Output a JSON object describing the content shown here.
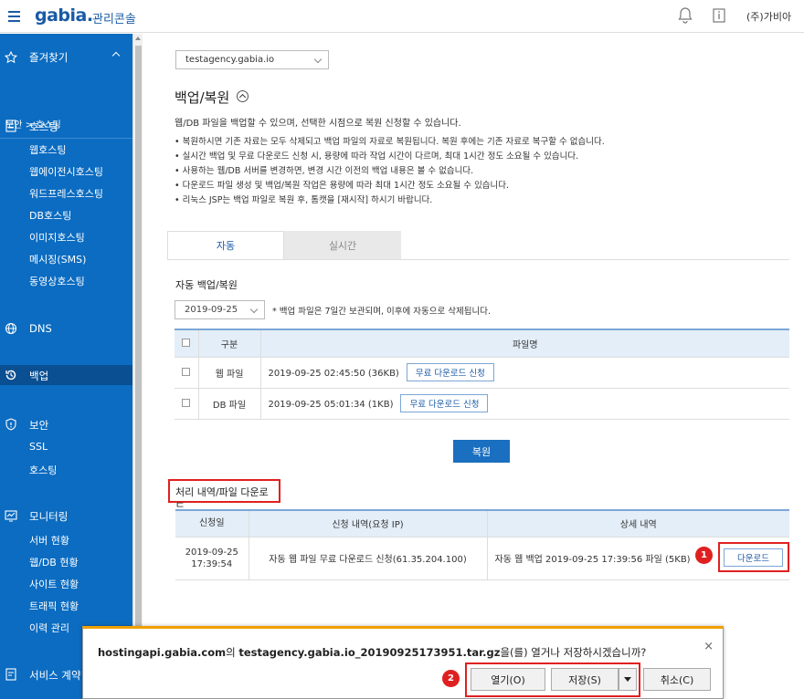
{
  "topbar": {
    "logo": "gabia.",
    "console": "관리콘솔",
    "user": "(주)가비아"
  },
  "sidebar": {
    "favorites": "즐겨찾기",
    "breadcrumb": "보안 > 호스팅",
    "hosting": "호스팅",
    "hosting_items": [
      "웹호스팅",
      "웹에이전시호스팅",
      "워드프레스호스팅",
      "DB호스팅",
      "이미지호스팅",
      "메시징(SMS)",
      "동영상호스팅"
    ],
    "dns": "DNS",
    "backup": "백업",
    "security": "보안",
    "security_items": [
      "SSL",
      "호스팅"
    ],
    "monitoring": "모니터링",
    "monitoring_items": [
      "서버 현황",
      "웹/DB 현황",
      "사이트 현황",
      "트래픽 현황",
      "이력 관리"
    ],
    "contract": "서비스 계약 관"
  },
  "main": {
    "site_select": "testagency.gabia.io",
    "title": "백업/복원",
    "desc": "웹/DB 파일을 백업할 수 있으며, 선택한 시점으로 복원 신청할 수 있습니다.",
    "notes": [
      "복원하시면 기존 자료는 모두 삭제되고 백업 파일의 자료로 복원됩니다. 복원 후에는 기존 자료로 복구할 수 없습니다.",
      "실시간 백업 및 무료 다운로드 신청 시, 용량에 따라 작업 시간이 다르며, 최대 1시간 정도 소요될 수 있습니다.",
      "사용하는 웹/DB 서버를 변경하면, 변경 시간 이전의 백업 내용은 볼 수 없습니다.",
      "다운로드 파일 생성 및 백업/복원 작업은 용량에 따라 최대 1시간 정도 소요될 수 있습니다.",
      "리눅스 JSP는 백업 파일로 복원 후, 톰캣을 [재시작] 하시기 바랍니다."
    ],
    "tabs": [
      "자동",
      "실시간"
    ],
    "auto_title": "자동 백업/복원",
    "date": "2019-09-25",
    "date_note": "* 백업 파일은 7일간 보관되며, 이후에 자동으로 삭제됩니다.",
    "table": {
      "headers": [
        "구분",
        "파일명"
      ],
      "rows": [
        {
          "type": "웹 파일",
          "file": "2019-09-25 02:45:50 (36KB)",
          "btn": "무료 다운로드 신청"
        },
        {
          "type": "DB 파일",
          "file": "2019-09-25 05:01:34 (1KB)",
          "btn": "무료 다운로드 신청"
        }
      ]
    },
    "restore_btn": "복원",
    "history_title": "처리 내역/파일 다운로드",
    "history": {
      "headers": [
        "신청일",
        "신청 내역(요청 IP)",
        "상세 내역"
      ],
      "row": {
        "date1": "2019-09-25",
        "date2": "17:39:54",
        "request": "자동 웹 파일 무료 다운로드 신청(61.35.204.100)",
        "detail": "자동 웹 백업 2019-09-25 17:39:56 파일 (5KB)",
        "btn": "다운로드"
      }
    },
    "marks": [
      "1",
      "2"
    ]
  },
  "dialog": {
    "host": "hostingapi.gabia.com",
    "mid": "의 ",
    "file": "testagency.gabia.io_20190925173951.tar.gz",
    "tail": "을(를) 열거나 저장하시겠습니까?",
    "open": "열기(O)",
    "save": "저장(S)",
    "cancel": "취소(C)",
    "close": "×"
  }
}
